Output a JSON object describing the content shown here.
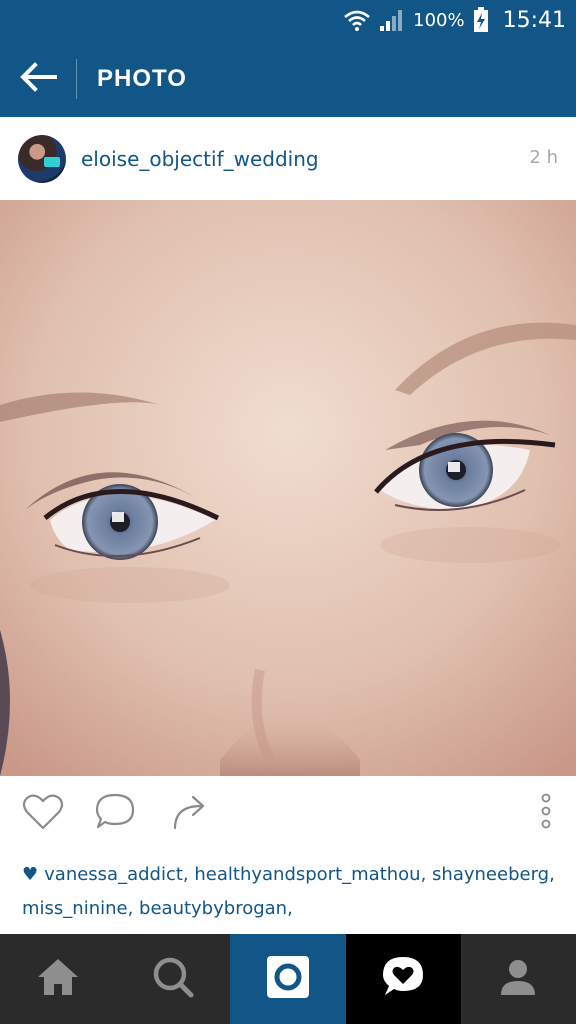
{
  "status_bar": {
    "battery_percent": "100%",
    "time": "15:41",
    "icons": [
      "wifi-icon",
      "signal-icon",
      "battery-icon"
    ]
  },
  "action_bar": {
    "title": "PHOTO",
    "back_icon": "back-arrow-icon"
  },
  "post": {
    "username": "eloise_objectif_wedding",
    "timestamp": "2 h",
    "likes_text": "vanessa_addict, healthyandsport_mathou, shayneeberg, miss_ninine, beautybybrogan,",
    "actions": [
      "heart-icon",
      "comment-icon",
      "share-icon",
      "more-icon"
    ]
  },
  "bottom_nav": {
    "items": [
      "home-icon",
      "search-icon",
      "camera-icon",
      "activity-icon",
      "profile-icon"
    ],
    "active": "activity-icon"
  },
  "colors": {
    "brand": "#125688",
    "nav_bg": "#2b2b2b",
    "timestamp": "#a8a8a8"
  }
}
